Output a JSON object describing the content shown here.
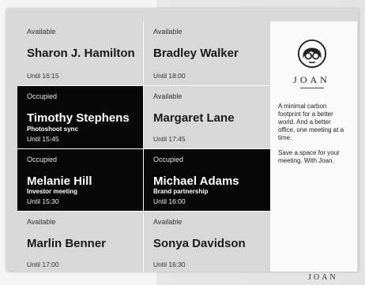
{
  "rooms": [
    {
      "status": "Available",
      "name": "Sharon J. Hamilton",
      "meeting": "",
      "until": "Until 16:15",
      "occupied": false
    },
    {
      "status": "Available",
      "name": "Bradley Walker",
      "meeting": "",
      "until": "Until 18:00",
      "occupied": false
    },
    {
      "status": "Occupied",
      "name": "Timothy Stephens",
      "meeting": "Photoshoot sync",
      "until": "Until 15:45",
      "occupied": true
    },
    {
      "status": "Available",
      "name": "Margaret Lane",
      "meeting": "",
      "until": "Until 17:45",
      "occupied": false
    },
    {
      "status": "Occupied",
      "name": "Melanie Hill",
      "meeting": "Investor meeting",
      "until": "Until 15:30",
      "occupied": true
    },
    {
      "status": "Occupied",
      "name": "Michael Adams",
      "meeting": "Brand partnership",
      "until": "Until 16:00",
      "occupied": true
    },
    {
      "status": "Available",
      "name": "Marlin Benner",
      "meeting": "",
      "until": "Until 17:00",
      "occupied": false
    },
    {
      "status": "Available",
      "name": "Sonya Davidson",
      "meeting": "",
      "until": "Until 16:30",
      "occupied": false
    }
  ],
  "info": {
    "logo_icon": "woman-with-glasses-icon",
    "brand": "JOAN",
    "tagline": "A minimal carbon footprint for a better world. And a better office, one meeting at a time.",
    "cta": "Save a space for your meeting. With Joan."
  },
  "footer": {
    "brand": "JOAN"
  },
  "colors": {
    "available_bg": "#d8d8d8",
    "occupied_bg": "#080808",
    "screen_bg": "#fafafa"
  }
}
